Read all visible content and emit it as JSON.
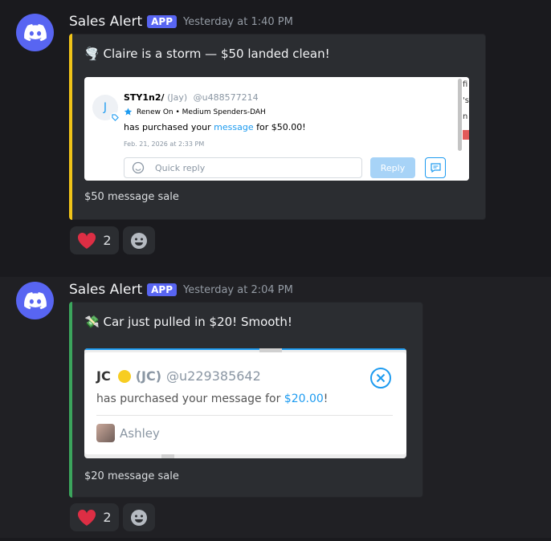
{
  "messages": [
    {
      "username": "Sales Alert",
      "badge": "APP",
      "timestamp": "Yesterday at 1:40 PM",
      "embed_title_emoji": "🌪️",
      "embed_title": "Claire is a storm — $50 landed clean!",
      "embed_color": "#f0c419",
      "card": {
        "avatar_letter": "J",
        "name": "STY1n2/",
        "nickname": "(Jay)",
        "handle": "@u488577214",
        "subscription": "Renew On • Medium Spenders-DAH",
        "purchase_prefix": "has purchased your ",
        "purchase_link": "message",
        "purchase_suffix": " for $50.00!",
        "date": "Feb. 21, 2026 at 2:33 PM",
        "quick_reply_placeholder": "Quick reply",
        "reply_button": "Reply",
        "side_fragments": [
          "fi",
          "'s",
          "n"
        ]
      },
      "embed_footer": "$50 message sale",
      "reactions": {
        "heart_count": "2"
      }
    },
    {
      "username": "Sales Alert",
      "badge": "APP",
      "timestamp": "Yesterday at 2:04 PM",
      "embed_title_emoji": "💸",
      "embed_title": "Car just pulled in $20! Smooth!",
      "embed_color": "#3ba55c",
      "card": {
        "name": "JC",
        "nickname": "(JC)",
        "handle": "@u229385642",
        "purchase_prefix": "has purchased your message for ",
        "purchase_amount": "$20.00",
        "purchase_suffix": "!",
        "model_name": "Ashley"
      },
      "embed_footer": "$20 message sale",
      "reactions": {
        "heart_count": "2"
      }
    }
  ],
  "colors": {
    "accent": "#5865f2",
    "link": "#1d9bf0"
  }
}
